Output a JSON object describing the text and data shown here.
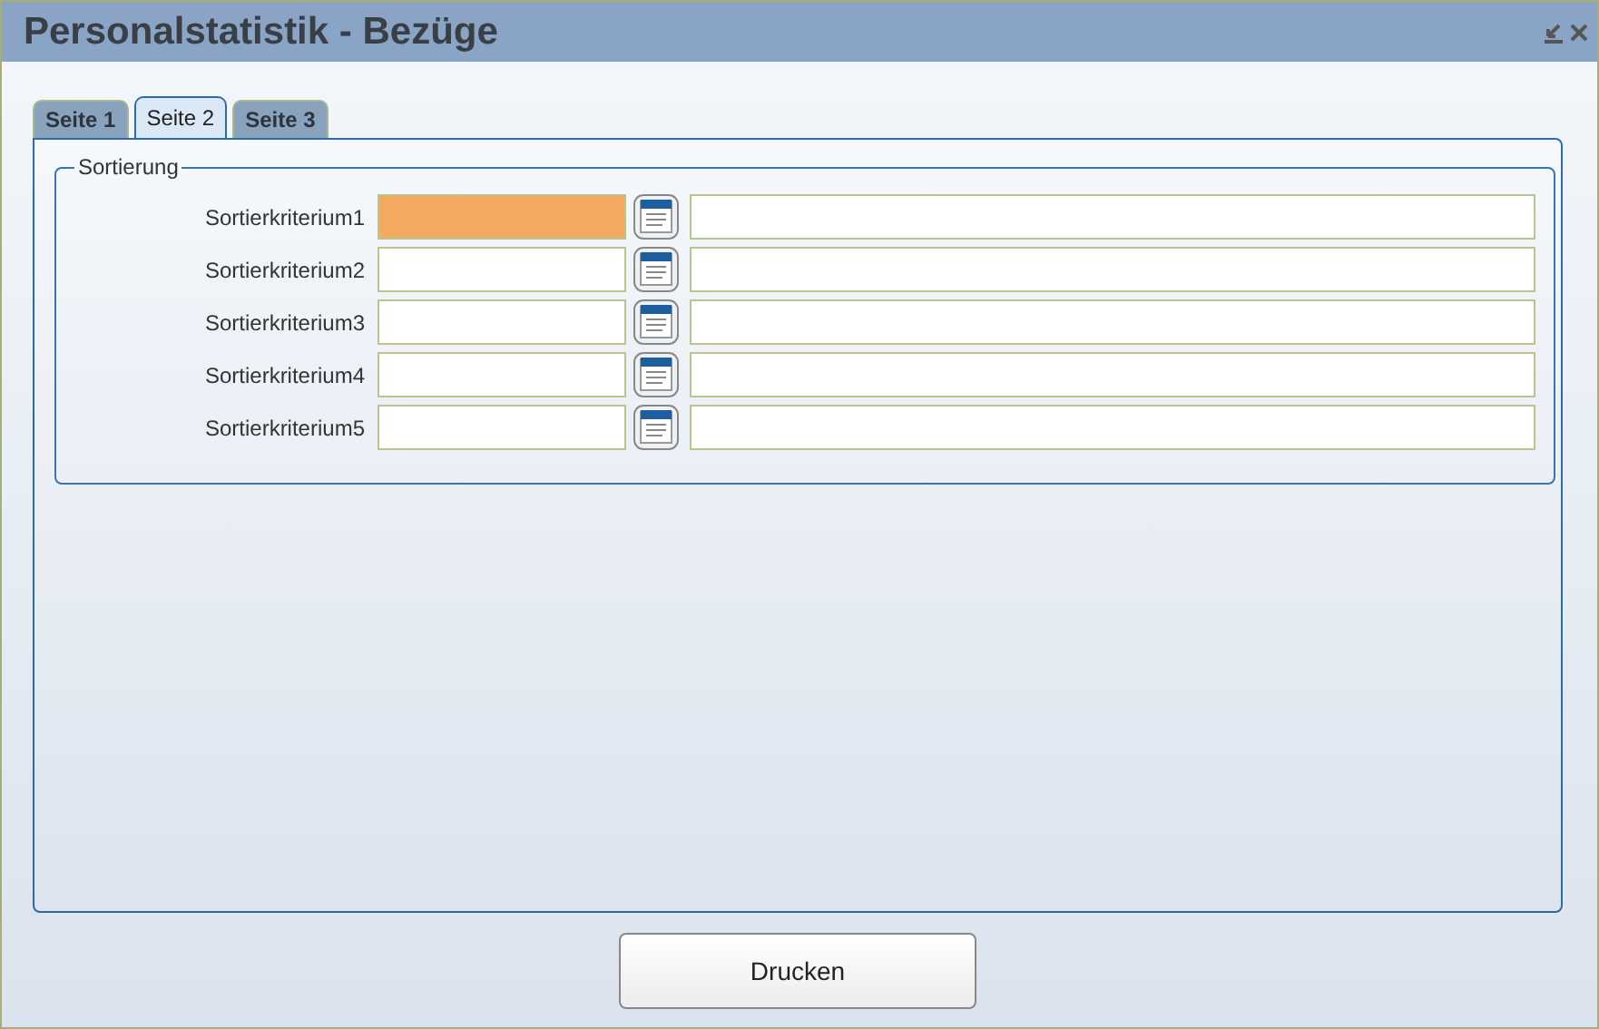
{
  "window": {
    "title": "Personalstatistik - Bezüge"
  },
  "tabs": [
    {
      "label": "Seite 1",
      "selected": false
    },
    {
      "label": "Seite 2",
      "selected": true
    },
    {
      "label": "Seite 3",
      "selected": false
    }
  ],
  "group": {
    "title": "Sortierung",
    "rows": [
      {
        "label": "Sortierkriterium1",
        "highlighted": true
      },
      {
        "label": "Sortierkriterium2",
        "highlighted": false
      },
      {
        "label": "Sortierkriterium3",
        "highlighted": false
      },
      {
        "label": "Sortierkriterium4",
        "highlighted": false
      },
      {
        "label": "Sortierkriterium5",
        "highlighted": false
      }
    ]
  },
  "buttons": [
    "Drucken"
  ]
}
